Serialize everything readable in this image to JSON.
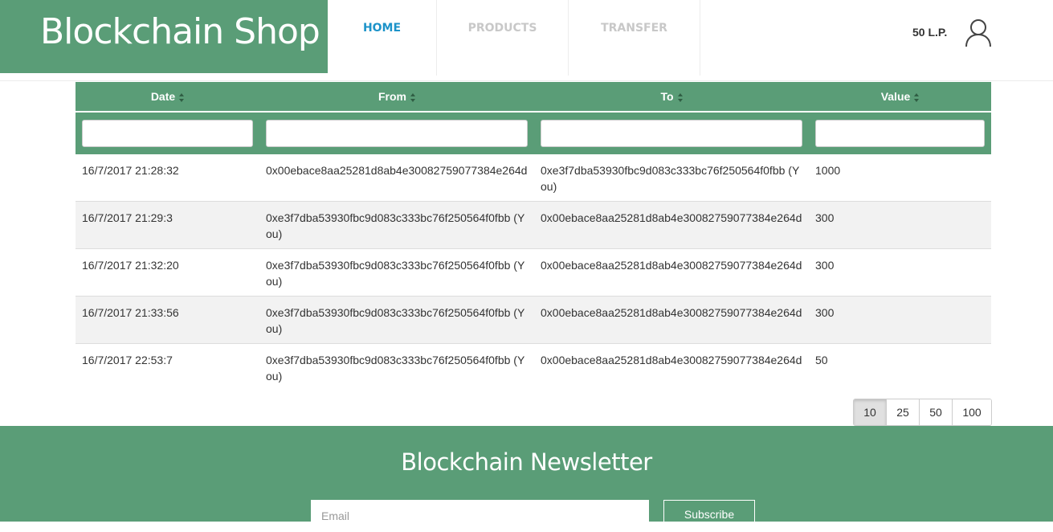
{
  "header": {
    "brand": "Blockchain Shop",
    "nav": [
      {
        "label": "HOME",
        "active": true
      },
      {
        "label": "PRODUCTS",
        "active": false
      },
      {
        "label": "TRANSFER",
        "active": false
      }
    ],
    "balance": "50 L.P.",
    "user_icon": "user-icon"
  },
  "table": {
    "columns": [
      "Date",
      "From",
      "To",
      "Value"
    ],
    "rows": [
      {
        "date": "16/7/2017 21:28:32",
        "from": "0x00ebace8aa25281d8ab4e30082759077384e264d",
        "from_you": "",
        "to": "0xe3f7dba53930fbc9d083c333bc76f250564f0fbb",
        "to_you": "(You)",
        "value": "1000"
      },
      {
        "date": "16/7/2017 21:29:3",
        "from": "0xe3f7dba53930fbc9d083c333bc76f250564f0fbb",
        "from_you": "(You)",
        "to": "0x00ebace8aa25281d8ab4e30082759077384e264d",
        "to_you": "",
        "value": "300"
      },
      {
        "date": "16/7/2017 21:32:20",
        "from": "0xe3f7dba53930fbc9d083c333bc76f250564f0fbb",
        "from_you": "(You)",
        "to": "0x00ebace8aa25281d8ab4e30082759077384e264d",
        "to_you": "",
        "value": "300"
      },
      {
        "date": "16/7/2017 21:33:56",
        "from": "0xe3f7dba53930fbc9d083c333bc76f250564f0fbb",
        "from_you": "(You)",
        "to": "0x00ebace8aa25281d8ab4e30082759077384e264d",
        "to_you": "",
        "value": "300"
      },
      {
        "date": "16/7/2017 22:53:7",
        "from": "0xe3f7dba53930fbc9d083c333bc76f250564f0fbb",
        "from_you": "(You)",
        "to": "0x00ebace8aa25281d8ab4e30082759077384e264d",
        "to_you": "",
        "value": "50"
      }
    ],
    "filters": [
      "",
      "",
      "",
      ""
    ]
  },
  "pager": {
    "sizes": [
      "10",
      "25",
      "50",
      "100"
    ],
    "active": "10"
  },
  "footer": {
    "title": "Blockchain Newsletter",
    "email_placeholder": "Email",
    "subscribe_label": "Subscribe"
  },
  "colors": {
    "brand_green": "#5a9d77",
    "nav_active": "#1d93c9",
    "nav_inactive": "#c8c8c8"
  }
}
